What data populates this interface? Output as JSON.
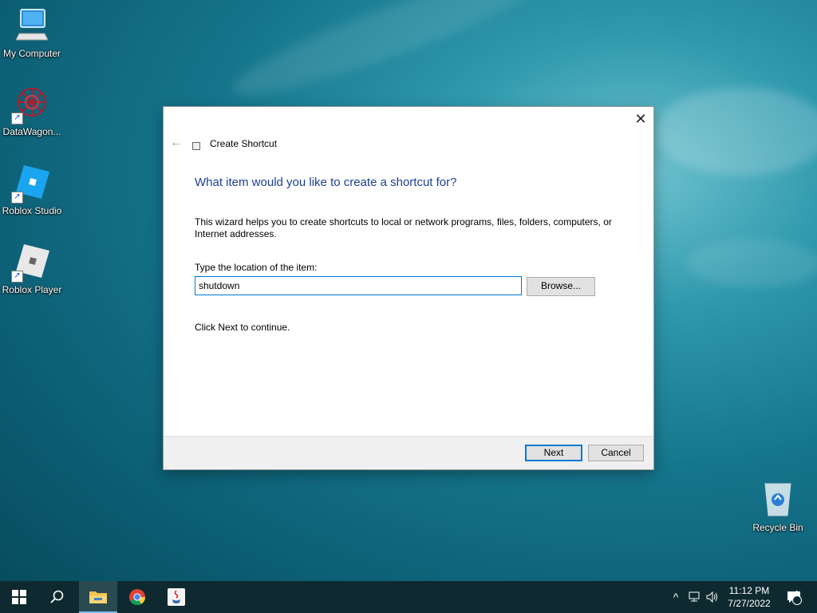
{
  "desktop": {
    "icons": [
      {
        "label": "My Computer",
        "icon": "computer-icon"
      },
      {
        "label": "DataWagon...",
        "icon": "datawagon-icon"
      },
      {
        "label": "Roblox Studio",
        "icon": "roblox-studio-icon"
      },
      {
        "label": "Roblox Player",
        "icon": "roblox-player-icon"
      },
      {
        "label": "Recycle Bin",
        "icon": "recycle-bin-icon"
      }
    ]
  },
  "dialog": {
    "title": "Create Shortcut",
    "heading": "What item would you like to create a shortcut for?",
    "description": "This wizard helps you to create shortcuts to local or network programs, files, folders, computers, or Internet addresses.",
    "location_label": "Type the location of the item:",
    "location_value": "shutdown",
    "browse_label": "Browse...",
    "hint": "Click Next to continue.",
    "next_label": "Next",
    "cancel_label": "Cancel",
    "accent_color": "#0078d7",
    "heading_color": "#1c3f94"
  },
  "taskbar": {
    "items": [
      "windows-start-icon",
      "search-icon",
      "file-explorer-icon",
      "chrome-icon",
      "java-icon"
    ],
    "clock": {
      "time": "11:12 PM",
      "date": "7/27/2022"
    },
    "tray_icons": [
      "chevron-up-icon",
      "network-icon",
      "volume-icon"
    ],
    "notification_count": "1",
    "background_color": "#0e2a30"
  }
}
